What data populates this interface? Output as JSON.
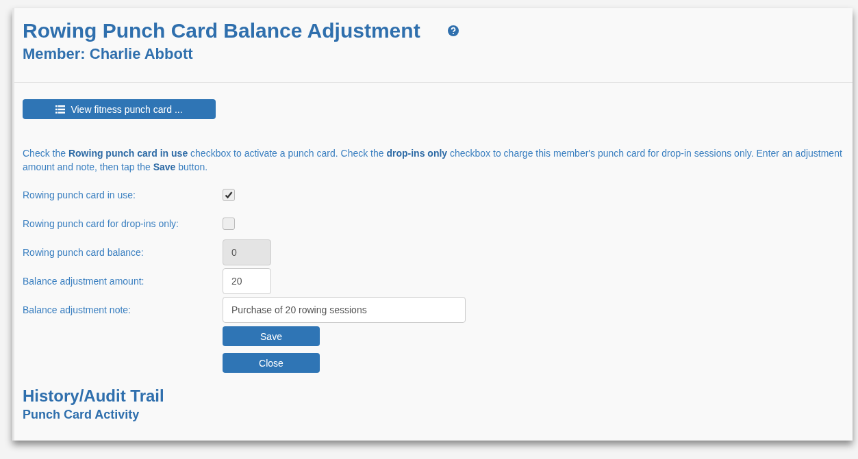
{
  "header": {
    "title": "Rowing Punch Card Balance Adjustment",
    "subtitle": "Member: Charlie Abbott"
  },
  "view_button": {
    "label": "View fitness punch card ..."
  },
  "instructions": "Check the **Rowing punch card in use** checkbox to activate a punch card. Check the **drop-ins only** checkbox to charge this member's punch card for drop-in sessions only. Enter an adjustment amount and note, then tap the **Save** button.",
  "fields": [
    {
      "kind": "checkbox",
      "label": "Rowing punch card in use:",
      "checked": true
    },
    {
      "kind": "checkbox",
      "label": "Rowing punch card for drop-ins only:",
      "checked": false
    },
    {
      "kind": "number",
      "label": "Rowing punch card balance:",
      "value": "0",
      "disabled": true
    },
    {
      "kind": "number",
      "label": "Balance adjustment amount:",
      "value": "20",
      "disabled": false
    },
    {
      "kind": "text",
      "label": "Balance adjustment note:",
      "value": "Purchase of 20 rowing sessions",
      "disabled": false
    }
  ],
  "buttons": [
    "Save",
    "Close"
  ],
  "history": {
    "title": "History/Audit Trail",
    "subtitle": "Punch Card Activity"
  }
}
